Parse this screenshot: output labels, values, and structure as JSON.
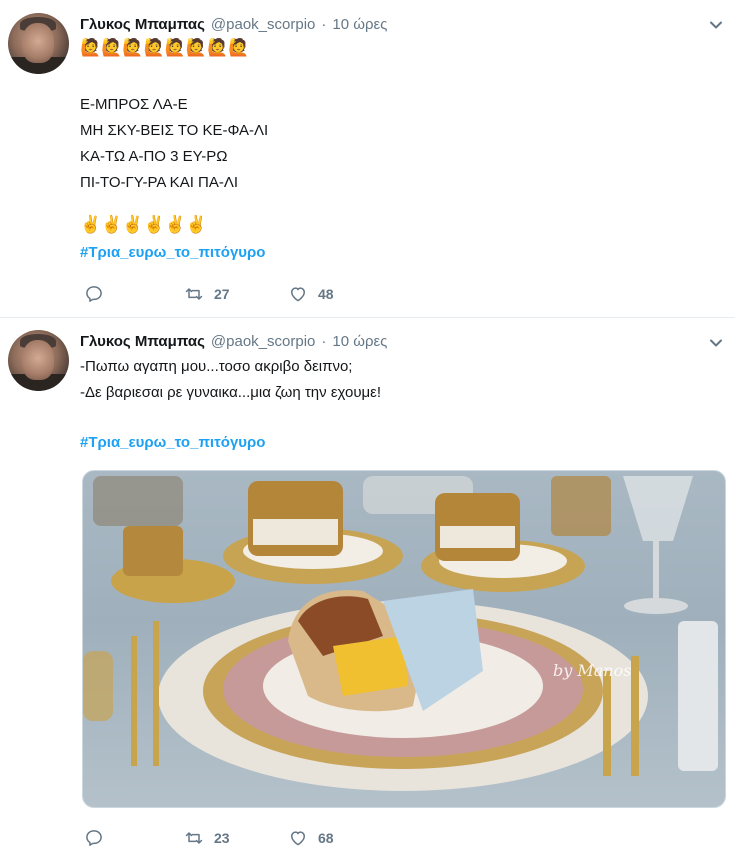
{
  "tweets": [
    {
      "author_name": "Γλυκος Μπαμπας",
      "handle": "@paok_scorpio",
      "separator": "·",
      "time": "10 ώρες",
      "emoji_top": "🙋🙋🙋🙋🙋🙋🙋🙋",
      "lines": [
        "Ε-ΜΠΡΟΣ ΛΑ-Ε",
        "ΜΗ ΣΚΥ-ΒΕΙΣ ΤΟ ΚΕ-ΦΑ-ΛΙ",
        "ΚΑ-ΤΩ Α-ΠΟ 3 ΕΥ-ΡΩ",
        "ΠΙ-ΤΟ-ΓΥ-ΡΑ ΚΑΙ ΠΑ-ΛΙ"
      ],
      "emoji_bottom": "✌️✌️✌️✌️✌️✌️",
      "hashtag": "#Τρια_ευρω_το_πιτόγυρο",
      "retweets": "27",
      "likes": "48"
    },
    {
      "author_name": "Γλυκος Μπαμπας",
      "handle": "@paok_scorpio",
      "separator": "·",
      "time": "10 ώρες",
      "lines": [
        "-Πωπω αγαπη μου...τοσο ακριβο δειπνο;",
        "-Δε βαριεσαι ρε γυναικα...μια ζωη την εχουμε!"
      ],
      "hashtag": "#Τρια_ευρω_το_πιτόγυρο",
      "image_watermark": "by Manos",
      "retweets": "23",
      "likes": "68"
    }
  ],
  "colors": {
    "accent": "#1da1f2",
    "secondary_text": "#657786",
    "divider": "#e6ecf0"
  },
  "icons": [
    "reply-icon",
    "retweet-icon",
    "like-icon",
    "chevron-down-icon"
  ]
}
